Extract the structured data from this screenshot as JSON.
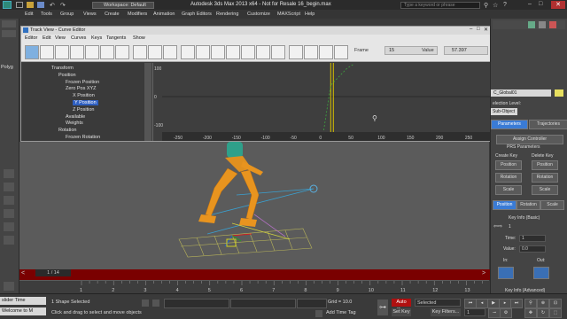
{
  "window": {
    "title": "Autodesk 3ds Max  2013 x64  - Not for Resale    16_begin.max",
    "workspace": "Workspace: Default",
    "search_placeholder": "Type a keyword or phrase"
  },
  "menubar": [
    "Edit",
    "Tools",
    "Group",
    "Views",
    "Create",
    "Modifiers",
    "Animation",
    "Graph Editors",
    "Rendering",
    "Customize",
    "MAXScript",
    "Help"
  ],
  "left_strip": {
    "item": "Polyg"
  },
  "curve_editor": {
    "title": "Track View - Curve Editor",
    "menu": [
      "Editor",
      "Edit",
      "View",
      "Curves",
      "Keys",
      "Tangents",
      "Show"
    ],
    "frame_label": "Frame",
    "frame_value": "15",
    "value_label": "Value",
    "value_value": "57.397",
    "tree": [
      {
        "label": "Transform",
        "level": 0,
        "selected": false
      },
      {
        "label": "Position",
        "level": 1,
        "selected": false
      },
      {
        "label": "Frozen Position",
        "level": 2,
        "selected": false
      },
      {
        "label": "Zero Pos XYZ",
        "level": 2,
        "selected": false
      },
      {
        "label": "X Position",
        "level": 3,
        "selected": false
      },
      {
        "label": "Y Position",
        "level": 3,
        "selected": true
      },
      {
        "label": "Z Position",
        "level": 3,
        "selected": false
      },
      {
        "label": "Available",
        "level": 2,
        "selected": false
      },
      {
        "label": "Weights",
        "level": 2,
        "selected": false
      },
      {
        "label": "Rotation",
        "level": 1,
        "selected": false
      },
      {
        "label": "Frozen Rotation",
        "level": 2,
        "selected": false
      }
    ],
    "graph": {
      "y_ticks": [
        "100",
        "0",
        "-100"
      ],
      "x_ticks": [
        "-250",
        "-200",
        "-150",
        "-100",
        "-50",
        "0",
        "50",
        "100",
        "150",
        "200",
        "250"
      ],
      "current_frame": 15,
      "colors": {
        "curve": "#3da63d",
        "time_slider": "#d8c000",
        "grid": "#2b2b2b"
      }
    }
  },
  "command_panel": {
    "name_field": "C_Global01",
    "selection_level_label": "election Level:",
    "sub_object": "Sub-Object",
    "tabs": [
      "Parameters",
      "Trajectories"
    ],
    "assign_controller": "Assign Controller",
    "prs_parameters": "PRS Parameters",
    "create_key": "Create Key",
    "delete_key": "Delete Key",
    "create_buttons": [
      "Position",
      "Rotation",
      "Scale"
    ],
    "delete_buttons": [
      "Position",
      "Rotation",
      "Scale"
    ],
    "mode_tabs": [
      "Position",
      "Rotation",
      "Scale"
    ],
    "key_info_basic": "Key Info (Basic)",
    "key_number": "1",
    "time_label": "Time:",
    "time_value": "1",
    "value_label": "Value:",
    "value_value": "0.0",
    "in_label": "In:",
    "out_label": "Out:",
    "key_info_advanced": "Key Info (Advanced)"
  },
  "timeline": {
    "frame_counter": "1 / 14",
    "ticks": [
      "1",
      "2",
      "3",
      "4",
      "5",
      "6",
      "7",
      "8",
      "9",
      "10",
      "11",
      "12",
      "13"
    ],
    "range_end": "13"
  },
  "status": {
    "maxscript_line1": "slider Time",
    "maxscript_line2": "Welcome to M",
    "selection_info": "1 Shape Selected",
    "prompt": "Click and drag to select and move objects",
    "grid": "Grid = 10.0",
    "add_time_tag": "Add Time Tag",
    "auto_key": "Auto Key",
    "set_key": "Set Key",
    "selected": "Selected",
    "key_filters": "Key Filters...",
    "frame_field": "1"
  }
}
